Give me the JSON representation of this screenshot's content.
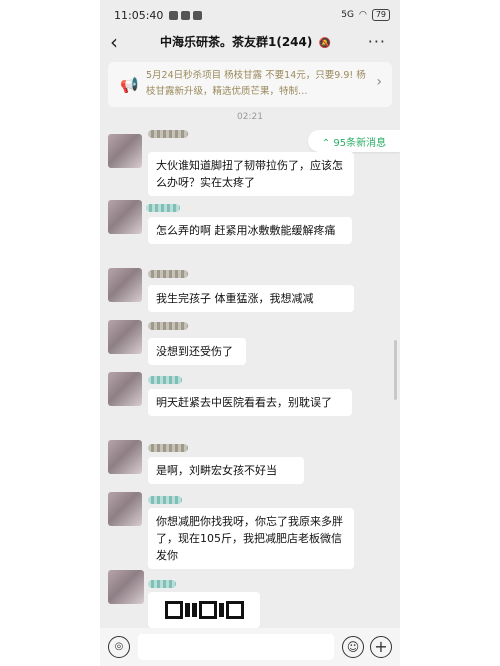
{
  "status_bar": {
    "time": "11:05:40",
    "battery": "79",
    "signal": "5G"
  },
  "header": {
    "back_icon": "‹",
    "title": "中海乐研茶。茶友群1(244)",
    "mute_icon": "🔕",
    "more_icon": "···"
  },
  "notice": {
    "text": "5月24日秒杀项目 杨枝甘露 不要14元，只要9.9! 杨枝甘露新升级，精选优质芒果，特制…",
    "horn_icon": "📢",
    "chevron": "›"
  },
  "time_separator": "02:21",
  "new_messages": "⌃ 95条新消息",
  "messages": [
    {
      "text": "大伙谁知道脚扭了韧带拉伤了，应该怎么办呀？实在太疼了"
    },
    {
      "text": "怎么弄的啊 赶紧用冰敷敷能缓解疼痛"
    },
    {
      "text": "我生完孩子 体重猛涨，我想减减"
    },
    {
      "text": "没想到还受伤了"
    },
    {
      "text": "明天赶紧去中医院看看去，别耽误了"
    },
    {
      "text": "是啊，刘畊宏女孩不好当"
    },
    {
      "text": "你想减肥你找我呀，你忘了我原来多胖了，现在105斤，我把减肥店老板微信发你"
    }
  ],
  "input_bar": {
    "voice_icon": "◎",
    "emoji_icon": "☺",
    "plus_icon": "+"
  }
}
